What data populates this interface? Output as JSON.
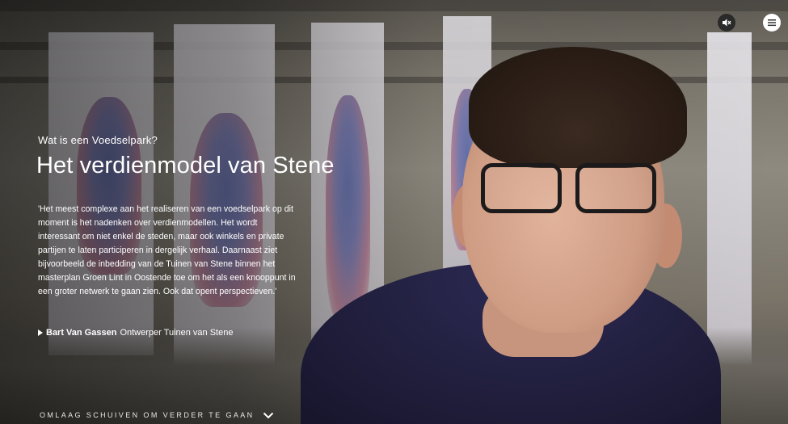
{
  "header": {
    "mute_icon": "speaker-muted-icon",
    "menu_icon": "hamburger-menu-icon"
  },
  "section": {
    "subtitle": "Wat is een Voedselpark?",
    "title": "Het verdienmodel van Stene"
  },
  "quote": {
    "text": "'Het meest complexe aan het realiseren van een voedselpark op dit moment is het nadenken over verdienmodellen. Het wordt interessant om niet enkel de steden, maar ook winkels en private partijen te laten participeren in dergelijk verhaal. Daarnaast ziet bijvoorbeeld de inbedding van de Tuinen van Stene binnen het masterplan Groen Lint in Oostende toe om het als een knooppunt in een groter netwerk te gaan zien. Ook dat opent perspectieven.'",
    "speaker_name": "Bart Van Gassen",
    "speaker_role": "Ontwerper Tuinen van Stene"
  },
  "footer": {
    "scroll_label": "OMLAAG SCHUIVEN OM VERDER TE GAAN",
    "scroll_icon": "chevron-down-icon"
  },
  "colors": {
    "text": "#ffffff",
    "shirt": "#22203f"
  }
}
